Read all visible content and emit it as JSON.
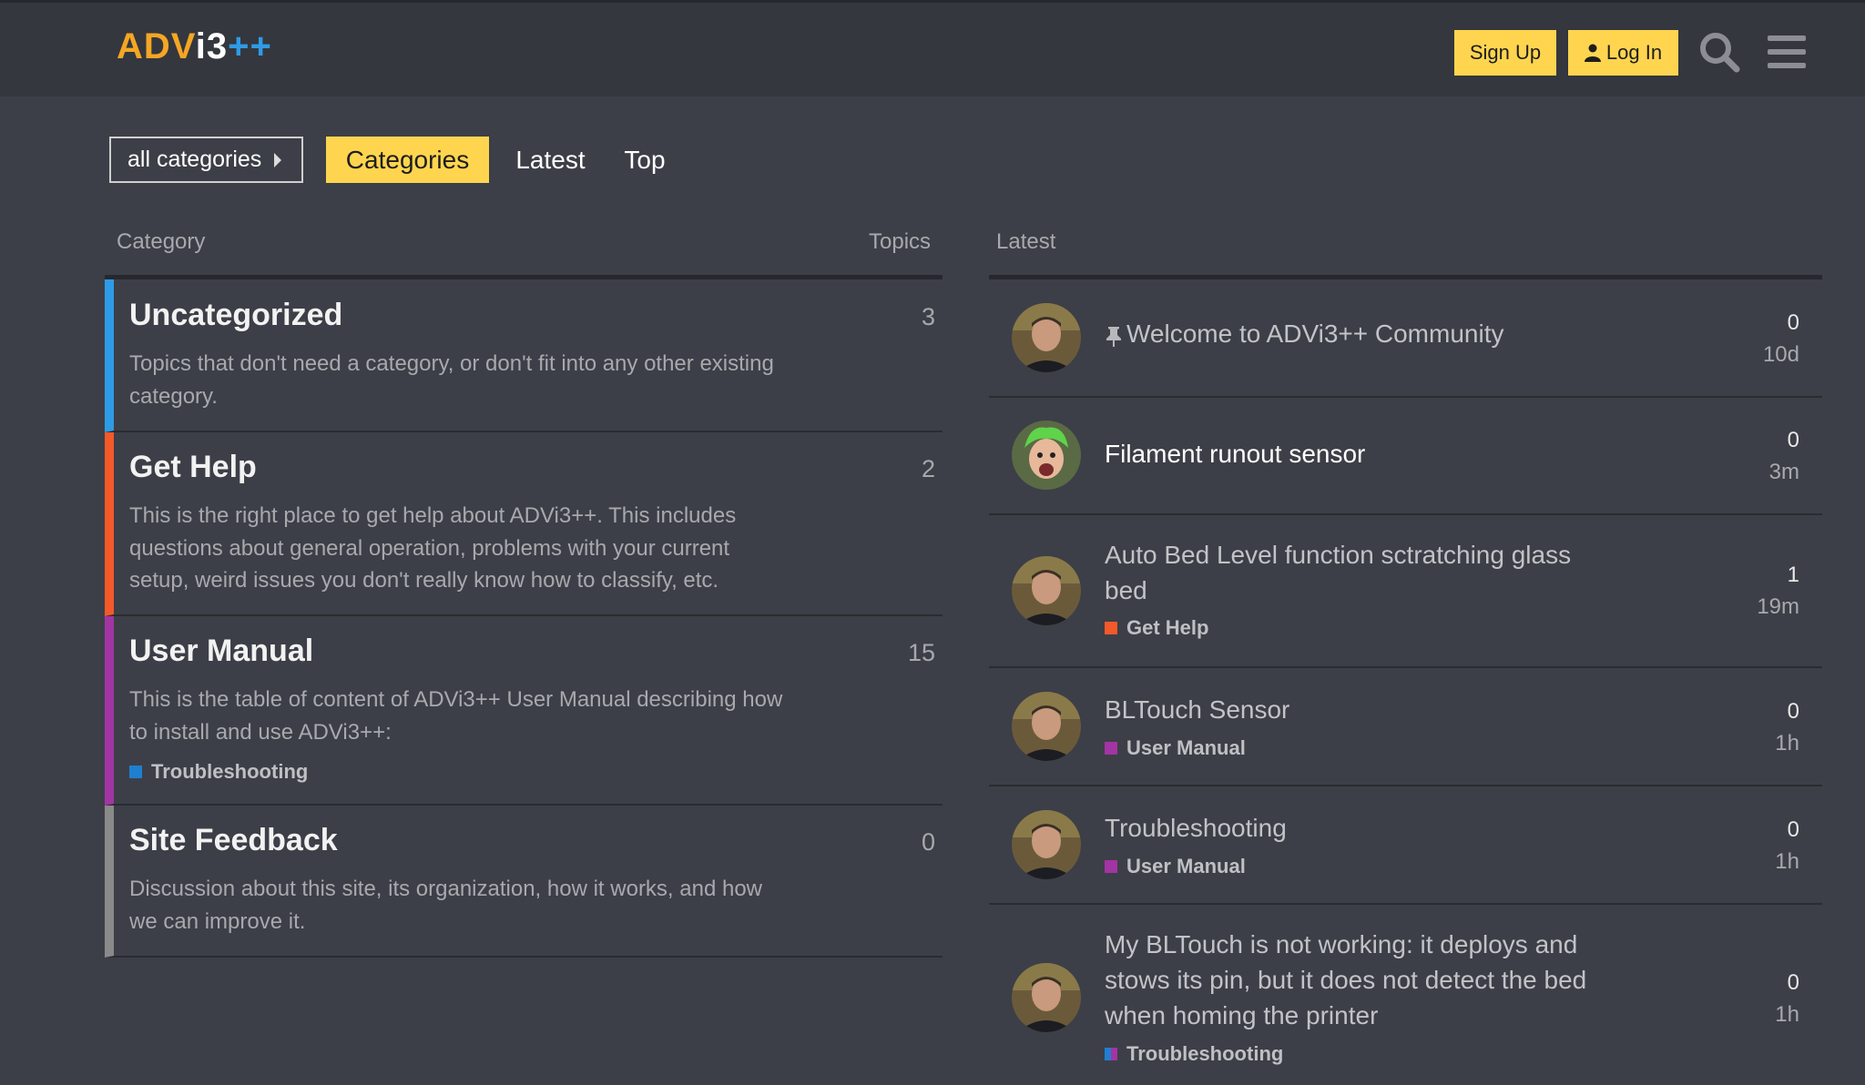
{
  "header": {
    "logo_part1": "ADV",
    "logo_part2": "i3",
    "logo_part3": "++",
    "signup_label": "Sign Up",
    "login_label": "Log In",
    "search_icon": "search-icon",
    "menu_icon": "hamburger-menu-icon"
  },
  "nav": {
    "category_selector": "all categories",
    "tabs": [
      {
        "label": "Categories",
        "active": true
      },
      {
        "label": "Latest",
        "active": false
      },
      {
        "label": "Top",
        "active": false
      }
    ]
  },
  "categories_table": {
    "col_category": "Category",
    "col_topics": "Topics",
    "rows": [
      {
        "name": "Uncategorized",
        "count": "3",
        "color": "#2e9be6",
        "description": "Topics that don't need a category, or don't fit into any other existing category."
      },
      {
        "name": "Get Help",
        "count": "2",
        "color": "#f4592a",
        "description": "This is the right place to get help about ADVi3++. This includes questions about general operation, problems with your current setup, weird issues you don't really know how to classify, etc."
      },
      {
        "name": "User Manual",
        "count": "15",
        "color": "#a334a3",
        "description": "This is the table of content of ADVi3++ User Manual describing how to install and use ADVi3++:",
        "subcategory": "Troubleshooting",
        "subcategory_color": "#1f7fd0"
      },
      {
        "name": "Site Feedback",
        "count": "0",
        "color": "#8a8a8a",
        "description": "Discussion about this site, its organization, how it works, and how we can improve it."
      }
    ]
  },
  "latest": {
    "heading": "Latest",
    "topics": [
      {
        "title": "Welcome to ADVi3++ Community",
        "pinned": true,
        "replies": "0",
        "age": "10d",
        "category": ""
      },
      {
        "title": "Filament runout sensor",
        "replies": "0",
        "age": "3m",
        "category": ""
      },
      {
        "title": "Auto Bed Level function sctratching glass bed",
        "replies": "1",
        "age": "19m",
        "category": "Get Help",
        "category_color": "#f4592a"
      },
      {
        "title": "BLTouch Sensor",
        "replies": "0",
        "age": "1h",
        "category": "User Manual",
        "category_color": "#a334a3"
      },
      {
        "title": "Troubleshooting",
        "replies": "0",
        "age": "1h",
        "category": "User Manual",
        "category_color": "#a334a3"
      },
      {
        "title": "My BLTouch is not working: it deploys and stows its pin, but it does not detect the bed when homing the printer",
        "replies": "0",
        "age": "1h",
        "category": "Troubleshooting",
        "category_color": "#1f7fd0"
      }
    ]
  },
  "colors": {
    "accent_yellow": "#ffd54f",
    "background": "#3c3f47",
    "header_bg": "#34373e"
  }
}
